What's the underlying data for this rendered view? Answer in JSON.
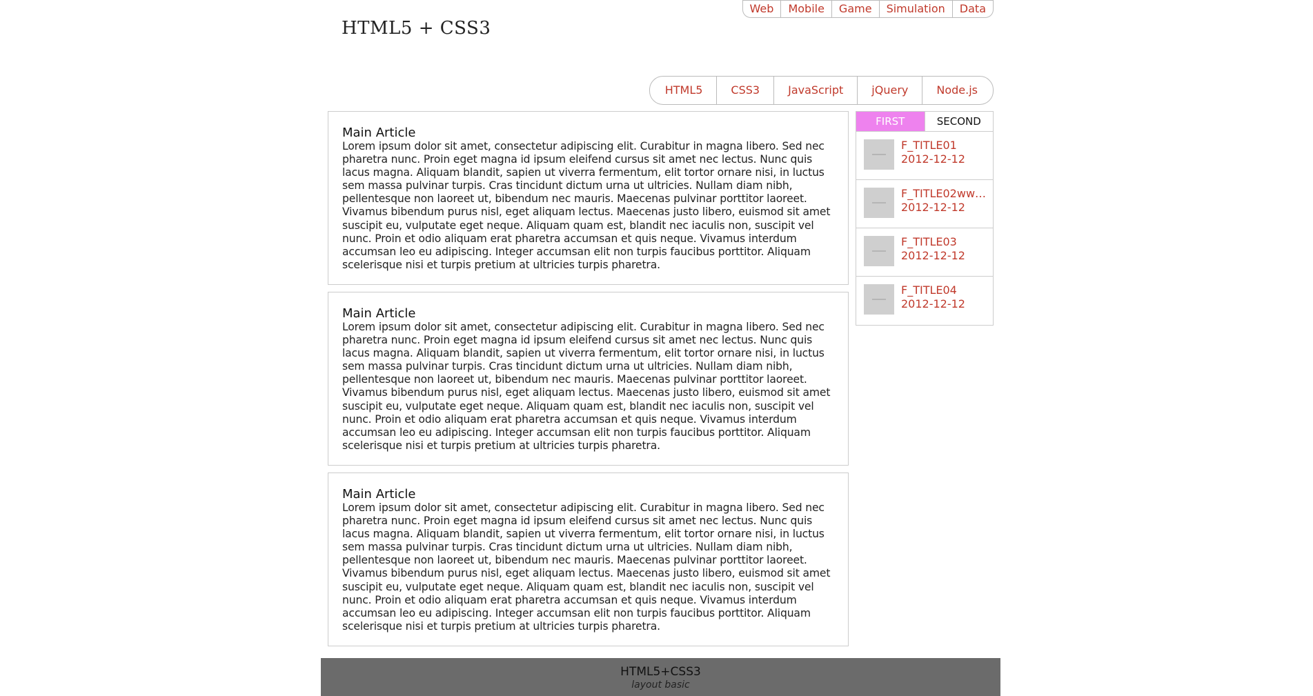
{
  "header": {
    "title": "HTML5 + CSS3",
    "top_nav": [
      "Web",
      "Mobile",
      "Game",
      "Simulation",
      "Data"
    ]
  },
  "main_nav": [
    "HTML5",
    "CSS3",
    "JavaScript",
    "jQuery",
    "Node.js"
  ],
  "articles": [
    {
      "heading": "Main Article",
      "body": "Lorem ipsum dolor sit amet, consectetur adipiscing elit. Curabitur in magna libero. Sed nec pharetra nunc. Proin eget magna id ipsum eleifend cursus sit amet nec lectus. Nunc quis lacus magna. Aliquam blandit, sapien ut viverra fermentum, elit tortor ornare nisi, in luctus sem massa pulvinar turpis. Cras tincidunt dictum urna ut ultricies. Nullam diam nibh, pellentesque non laoreet ut, bibendum nec mauris. Maecenas pulvinar porttitor laoreet. Vivamus bibendum purus nisl, eget aliquam lectus. Maecenas justo libero, euismod sit amet suscipit eu, vulputate eget neque. Aliquam quam est, blandit nec iaculis non, suscipit vel nunc. Proin et odio aliquam erat pharetra accumsan et quis neque. Vivamus interdum accumsan leo eu adipiscing. Integer accumsan elit non turpis faucibus porttitor. Aliquam scelerisque nisi et turpis pretium at ultricies turpis pharetra."
    },
    {
      "heading": "Main Article",
      "body": "Lorem ipsum dolor sit amet, consectetur adipiscing elit. Curabitur in magna libero. Sed nec pharetra nunc. Proin eget magna id ipsum eleifend cursus sit amet nec lectus. Nunc quis lacus magna. Aliquam blandit, sapien ut viverra fermentum, elit tortor ornare nisi, in luctus sem massa pulvinar turpis. Cras tincidunt dictum urna ut ultricies. Nullam diam nibh, pellentesque non laoreet ut, bibendum nec mauris. Maecenas pulvinar porttitor laoreet. Vivamus bibendum purus nisl, eget aliquam lectus. Maecenas justo libero, euismod sit amet suscipit eu, vulputate eget neque. Aliquam quam est, blandit nec iaculis non, suscipit vel nunc. Proin et odio aliquam erat pharetra accumsan et quis neque. Vivamus interdum accumsan leo eu adipiscing. Integer accumsan elit non turpis faucibus porttitor. Aliquam scelerisque nisi et turpis pretium at ultricies turpis pharetra."
    },
    {
      "heading": "Main Article",
      "body": "Lorem ipsum dolor sit amet, consectetur adipiscing elit. Curabitur in magna libero. Sed nec pharetra nunc. Proin eget magna id ipsum eleifend cursus sit amet nec lectus. Nunc quis lacus magna. Aliquam blandit, sapien ut viverra fermentum, elit tortor ornare nisi, in luctus sem massa pulvinar turpis. Cras tincidunt dictum urna ut ultricies. Nullam diam nibh, pellentesque non laoreet ut, bibendum nec mauris. Maecenas pulvinar porttitor laoreet. Vivamus bibendum purus nisl, eget aliquam lectus. Maecenas justo libero, euismod sit amet suscipit eu, vulputate eget neque. Aliquam quam est, blandit nec iaculis non, suscipit vel nunc. Proin et odio aliquam erat pharetra accumsan et quis neque. Vivamus interdum accumsan leo eu adipiscing. Integer accumsan elit non turpis faucibus porttitor. Aliquam scelerisque nisi et turpis pretium at ultricies turpis pharetra."
    }
  ],
  "aside": {
    "tabs": [
      "FIRST",
      "SECOND"
    ],
    "active_tab_color": "#ee82ee",
    "items": [
      {
        "title": "F_TITLE01",
        "date": "2012-12-12"
      },
      {
        "title": "F_TITLE02www...",
        "date": "2012-12-12"
      },
      {
        "title": "F_TITLE03",
        "date": "2012-12-12"
      },
      {
        "title": "F_TITLE04",
        "date": "2012-12-12"
      }
    ]
  },
  "footer": {
    "title": "HTML5+CSS3",
    "subtitle": "layout basic"
  },
  "colors": {
    "link": "#c0392b",
    "footer_bg": "#6b6b6b"
  }
}
